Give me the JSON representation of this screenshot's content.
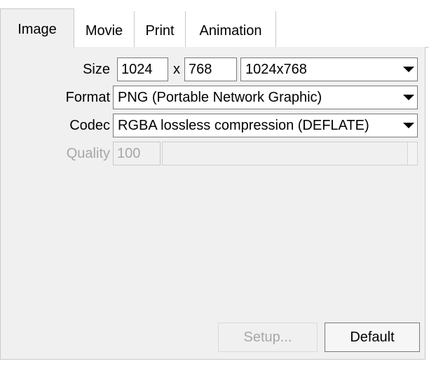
{
  "tabs": [
    {
      "label": "Image",
      "active": true
    },
    {
      "label": "Movie",
      "active": false
    },
    {
      "label": "Print",
      "active": false
    },
    {
      "label": "Animation",
      "active": false
    }
  ],
  "size": {
    "label": "Size",
    "width": "1024",
    "separator": "x",
    "height": "768",
    "preset": "1024x768"
  },
  "format": {
    "label": "Format",
    "value": "PNG (Portable Network Graphic)"
  },
  "codec": {
    "label": "Codec",
    "value": "RGBA lossless compression (DEFLATE)"
  },
  "quality": {
    "label": "Quality",
    "value": "100",
    "enabled": false
  },
  "buttons": {
    "setup": "Setup...",
    "default": "Default"
  },
  "icons": {
    "dropdown": "chevron-down-icon"
  },
  "colors": {
    "panel_bg": "#f0f0f0",
    "disabled_text": "#a7a7a7",
    "border": "#7a7a7a"
  }
}
